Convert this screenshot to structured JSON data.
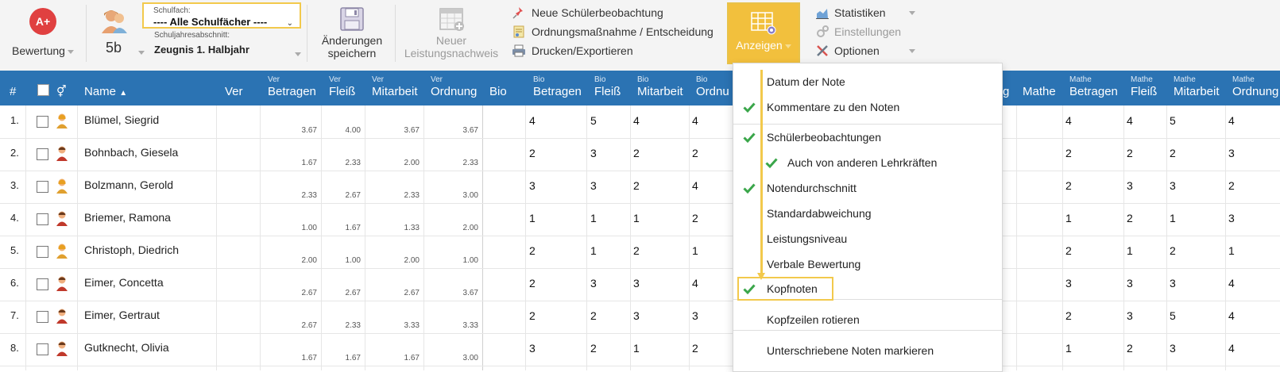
{
  "toolbar": {
    "grade_label": "Bewertung",
    "grade_icon_text": "A+",
    "class_label": "5b",
    "schulfach_label": "Schulfach:",
    "schulfach_value": "---- Alle Schulfächer ----",
    "halbjahr_label": "Schuljahresabschnitt:",
    "halbjahr_value": "Zeugnis 1. Halbjahr",
    "save_line1": "Änderungen",
    "save_line2": "speichern",
    "new_line1": "Neuer",
    "new_line2": "Leistungsnachweis",
    "menu": [
      {
        "label": "Neue Schülerbeobachtung",
        "icon": "pin-icon"
      },
      {
        "label": "Ordnungsmaßnahme / Entscheidung",
        "icon": "document-icon"
      },
      {
        "label": "Drucken/Exportieren",
        "icon": "printer-icon"
      }
    ],
    "anzeigen_label": "Anzeigen",
    "side_menu": [
      {
        "label": "Statistiken",
        "icon": "chart-icon",
        "disabled": false
      },
      {
        "label": "Einstellungen",
        "icon": "gears-icon",
        "disabled": true
      },
      {
        "label": "Optionen",
        "icon": "tools-icon",
        "disabled": false
      }
    ]
  },
  "table": {
    "headers": {
      "num": "#",
      "name": "Name",
      "sort_arrow": "▲",
      "ver": "Ver",
      "bio": "Bio",
      "mathe": "Mathe",
      "partial_g": "g"
    },
    "groups": [
      {
        "prefix": "Ver",
        "cols": [
          "Betragen",
          "Fleiß",
          "Mitarbeit",
          "Ordnung"
        ]
      },
      {
        "prefix": "Bio",
        "cols": [
          "Betragen",
          "Fleiß",
          "Mitarbeit",
          "Ordnu"
        ]
      },
      {
        "prefix": "Mathe",
        "cols": [
          "Betragen",
          "Fleiß",
          "Mitarbeit",
          "Ordnung"
        ]
      }
    ],
    "rows": [
      {
        "num": "1.",
        "name": "Blümel, Siegrid",
        "gender": "f",
        "ver": [
          "3.67",
          "4.00",
          "3.67",
          "3.67"
        ],
        "bio": [
          "4",
          "5",
          "4",
          "4"
        ],
        "mathe": [
          "4",
          "4",
          "5",
          "4"
        ]
      },
      {
        "num": "2.",
        "name": "Bohnbach, Giesela",
        "gender": "m",
        "ver": [
          "1.67",
          "2.33",
          "2.00",
          "2.33"
        ],
        "bio": [
          "2",
          "3",
          "2",
          "2"
        ],
        "mathe": [
          "2",
          "2",
          "2",
          "3"
        ]
      },
      {
        "num": "3.",
        "name": "Bolzmann, Gerold",
        "gender": "f",
        "ver": [
          "2.33",
          "2.67",
          "2.33",
          "3.00"
        ],
        "bio": [
          "3",
          "3",
          "2",
          "4"
        ],
        "mathe": [
          "2",
          "3",
          "3",
          "2"
        ]
      },
      {
        "num": "4.",
        "name": "Briemer, Ramona",
        "gender": "m",
        "ver": [
          "1.00",
          "1.67",
          "1.33",
          "2.00"
        ],
        "bio": [
          "1",
          "1",
          "1",
          "2"
        ],
        "mathe": [
          "1",
          "2",
          "1",
          "3"
        ]
      },
      {
        "num": "5.",
        "name": "Christoph, Diedrich",
        "gender": "f",
        "ver": [
          "2.00",
          "1.00",
          "2.00",
          "1.00"
        ],
        "bio": [
          "2",
          "1",
          "2",
          "1"
        ],
        "mathe": [
          "2",
          "1",
          "2",
          "1"
        ]
      },
      {
        "num": "6.",
        "name": "Eimer, Concetta",
        "gender": "m",
        "ver": [
          "2.67",
          "2.67",
          "2.67",
          "3.67"
        ],
        "bio": [
          "2",
          "3",
          "3",
          "4"
        ],
        "mathe": [
          "3",
          "3",
          "3",
          "4"
        ]
      },
      {
        "num": "7.",
        "name": "Eimer, Gertraut",
        "gender": "m",
        "ver": [
          "2.67",
          "2.33",
          "3.33",
          "3.33"
        ],
        "bio": [
          "2",
          "2",
          "3",
          "3"
        ],
        "mathe": [
          "2",
          "3",
          "5",
          "4"
        ]
      },
      {
        "num": "8.",
        "name": "Gutknecht, Olivia",
        "gender": "m",
        "ver": [
          "1.67",
          "1.67",
          "1.67",
          "3.00"
        ],
        "bio": [
          "3",
          "2",
          "1",
          "2"
        ],
        "mathe": [
          "1",
          "2",
          "3",
          "4"
        ]
      }
    ]
  },
  "dropdown": {
    "items": [
      {
        "label": "Datum der Note",
        "checked": false,
        "indent": false
      },
      {
        "label": "Kommentare zu den Noten",
        "checked": true,
        "indent": false
      },
      {
        "label": "Schülerbeobachtungen",
        "checked": true,
        "indent": false
      },
      {
        "label": "Auch von anderen Lehrkräften",
        "checked": true,
        "indent": true
      },
      {
        "label": "Notendurchschnitt",
        "checked": true,
        "indent": false
      },
      {
        "label": "Standardabweichung",
        "checked": false,
        "indent": false
      },
      {
        "label": "Leistungsniveau",
        "checked": false,
        "indent": false
      },
      {
        "label": "Verbale Bewertung",
        "checked": false,
        "indent": false
      },
      {
        "label": "Kopfnoten",
        "checked": true,
        "indent": false
      },
      {
        "label": "Kopfzeilen rotieren",
        "checked": false,
        "indent": false
      },
      {
        "label": "Unterschriebene Noten markieren",
        "checked": false,
        "indent": false
      }
    ]
  },
  "colors": {
    "header_blue": "#2b73b3",
    "highlight_yellow": "#f2c94c",
    "check_green": "#3aa64a",
    "grade_red": "#e04040"
  }
}
